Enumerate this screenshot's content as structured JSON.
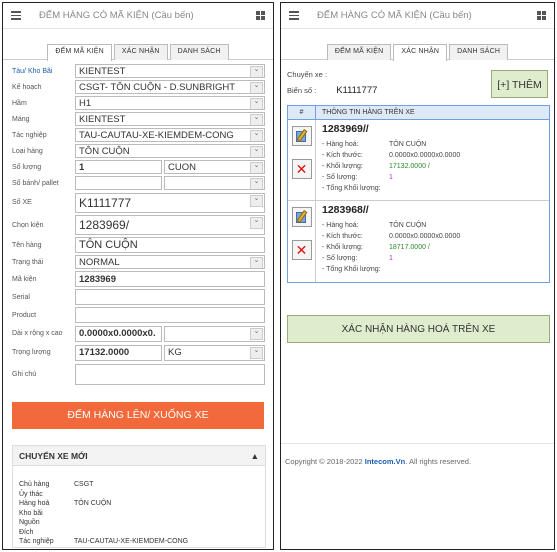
{
  "app_title": "ĐẾM HÀNG CÓ MÃ KIỆN (Cầu bến)",
  "tabs": [
    "ĐẾM MÃ KIỆN",
    "XÁC NHẬN",
    "DANH SÁCH"
  ],
  "left": {
    "fields": {
      "tau_kho_bai": {
        "label": "Tàu/ Kho Bãi",
        "value": "KIENTEST"
      },
      "ke_hoach": {
        "label": "Kế hoạch",
        "value": "CSGT- TÔN CUỘN - D.SUNBRIGHT"
      },
      "ham": {
        "label": "Hầm",
        "value": "H1"
      },
      "mang": {
        "label": "Máng",
        "value": "KIENTEST"
      },
      "tac_nghiep": {
        "label": "Tác nghiệp",
        "value": "TAU-CAUTAU-XE-KIEMDEM-CONG"
      },
      "loai_hang": {
        "label": "Loại hàng",
        "value": "TÔN CUỘN"
      },
      "so_luong": {
        "label": "Số lượng",
        "value": "1",
        "unit": "CUON"
      },
      "so_banh": {
        "label": "Số bánh/ pallet",
        "value": "",
        "unit": ""
      },
      "so_xe": {
        "label": "Số XE",
        "value": "K1111777"
      },
      "chon_kien": {
        "label": "Chọn kiện",
        "value": "1283969/"
      },
      "ten_hang": {
        "label": "Tên hàng",
        "value": "TÔN CUỘN"
      },
      "trang_thai": {
        "label": "Trạng thái",
        "value": "NORMAL"
      },
      "ma_kien": {
        "label": "Mã kiện",
        "value": "1283969"
      },
      "serial": {
        "label": "Serial",
        "value": ""
      },
      "product": {
        "label": "Product",
        "value": ""
      },
      "dai_rong_cao": {
        "label": "Dài x rộng x cao",
        "value": "0.0000x0.0000x0.",
        "unit": ""
      },
      "trong_luong": {
        "label": "Trọng lượng",
        "value": "17132.0000",
        "unit": "KG"
      },
      "ghi_chu": {
        "label": "Ghi chú",
        "value": ""
      }
    },
    "submit_label": "ĐẾM HÀNG LÊN/ XUỐNG XE",
    "card": {
      "title": "CHUYẾN XE MỚI",
      "rows": [
        {
          "k": "Chủ hàng",
          "v": "CSGT"
        },
        {
          "k": "Ủy thác",
          "v": ""
        },
        {
          "k": "Hàng hoá",
          "v": "TÔN CUỘN"
        },
        {
          "k": "Kho bãi",
          "v": ""
        },
        {
          "k": "Nguồn",
          "v": ""
        },
        {
          "k": "Đích",
          "v": ""
        },
        {
          "k": "Tác nghiệp",
          "v": "TAU-CAUTAU-XE-KIEMDEM-CONG"
        }
      ]
    }
  },
  "right": {
    "chuyen_xe_label": "Chuyến xe :",
    "bien_so_label": "Biển số :",
    "bien_so_value": "K1111777",
    "them_label": "[+] THÊM",
    "table_head": {
      "c1": "#",
      "c2": "THÔNG TIN HÀNG TRÊN XE"
    },
    "items": [
      {
        "code": "1283969//",
        "hang_hoa": "TÔN CUỘN",
        "kich_thuoc": "0.0000x0.0000x0.0000",
        "khoi_luong": "17132.0000 /",
        "so_luong": "1",
        "tong": ""
      },
      {
        "code": "1283968//",
        "hang_hoa": "TÔN CUỘN",
        "kich_thuoc": "0.0000x0.0000x0.0000",
        "khoi_luong": "18717.0000 /",
        "so_luong": "1",
        "tong": ""
      }
    ],
    "item_labels": {
      "hang_hoa": "- Hàng hoá:",
      "kich_thuoc": "- Kích thước:",
      "khoi_luong": "- Khối lượng:",
      "so_luong": "- Số lượng:",
      "tong": "- Tổng Khối lượng:"
    },
    "confirm_label": "XÁC NHẬN HÀNG HOÁ TRÊN XE",
    "footer": {
      "copyright": "Copyright © 2018-2022",
      "brand": "Intecom.Vn",
      "rights": ". All rights reserved."
    }
  }
}
